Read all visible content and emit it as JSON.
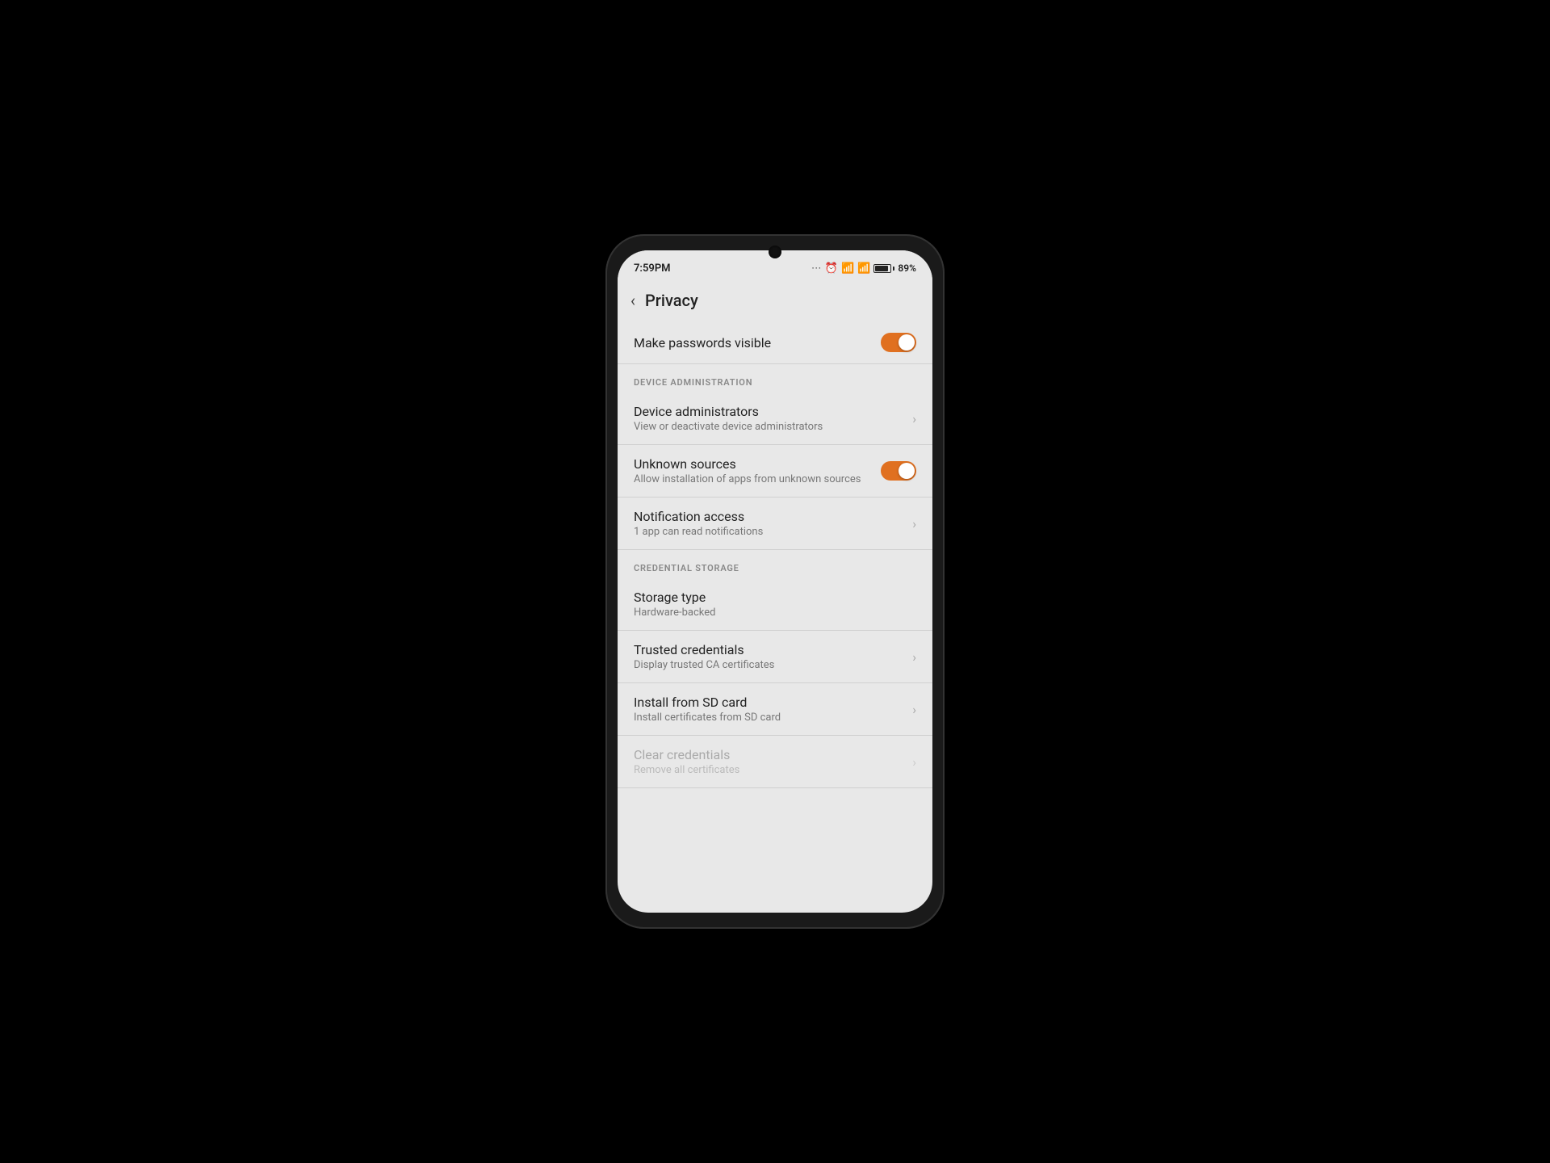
{
  "statusBar": {
    "time": "7:59PM",
    "battery": "89%",
    "batteryPercent": 89
  },
  "header": {
    "title": "Privacy",
    "backLabel": "‹"
  },
  "sections": [
    {
      "id": "passwords",
      "items": [
        {
          "id": "make-passwords-visible",
          "title": "Make passwords visible",
          "subtitle": "",
          "type": "toggle",
          "toggleState": "on",
          "disabled": false
        }
      ]
    },
    {
      "id": "device-administration",
      "label": "DEVICE ADMINISTRATION",
      "items": [
        {
          "id": "device-administrators",
          "title": "Device administrators",
          "subtitle": "View or deactivate device administrators",
          "type": "chevron",
          "disabled": false
        },
        {
          "id": "unknown-sources",
          "title": "Unknown sources",
          "subtitle": "Allow installation of apps from unknown sources",
          "type": "toggle",
          "toggleState": "on",
          "disabled": false
        },
        {
          "id": "notification-access",
          "title": "Notification access",
          "subtitle": "1 app can read notifications",
          "type": "chevron",
          "disabled": false
        }
      ]
    },
    {
      "id": "credential-storage",
      "label": "CREDENTIAL STORAGE",
      "items": [
        {
          "id": "storage-type",
          "title": "Storage type",
          "subtitle": "Hardware-backed",
          "type": "none",
          "disabled": false
        },
        {
          "id": "trusted-credentials",
          "title": "Trusted credentials",
          "subtitle": "Display trusted CA certificates",
          "type": "chevron",
          "disabled": false
        },
        {
          "id": "install-from-sd",
          "title": "Install from SD card",
          "subtitle": "Install certificates from SD card",
          "type": "chevron",
          "disabled": false
        },
        {
          "id": "clear-credentials",
          "title": "Clear credentials",
          "subtitle": "Remove all certificates",
          "type": "chevron",
          "disabled": true
        }
      ]
    }
  ]
}
